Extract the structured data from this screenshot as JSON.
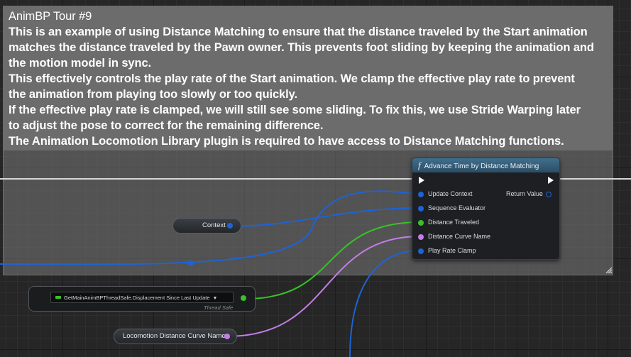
{
  "comment": {
    "lines": [
      "AnimBP Tour #9",
      "This is an example of using Distance Matching to ensure that the distance traveled by the Start animation",
      "matches the distance traveled by the Pawn owner. This prevents foot sliding by keeping the animation and",
      "the motion model in sync.",
      "This effectively controls the play rate of the Start animation. We clamp the effective play rate to prevent",
      "the animation from playing too slowly or too quickly.",
      "If the effective play rate is clamped, we will still see some sliding. To fix this, we use Stride Warping later",
      "to adjust the pose to correct for the remaining difference.",
      "The Animation Locomotion Library plugin is required to have access to Distance Matching functions."
    ]
  },
  "function_node": {
    "title": "Advance Time by Distance Matching",
    "icon": "function-icon",
    "inputs": [
      "Update Context",
      "Sequence Evaluator",
      "Distance Traveled",
      "Distance Curve Name",
      "Play Rate Clamp"
    ],
    "output": "Return Value"
  },
  "context_node": {
    "label": "Context"
  },
  "getter_node": {
    "field": "GetMainAnimBPThreadSafe.Displacement Since Last Update",
    "tag": "Thread Safe"
  },
  "curve_name_node": {
    "label": "Locomotion Distance Curve Name"
  },
  "colors": {
    "struct_pin": "#1e63d6",
    "float_pin": "#37c228",
    "name_pin": "#c47ce8",
    "header": "#3f6f8e"
  }
}
